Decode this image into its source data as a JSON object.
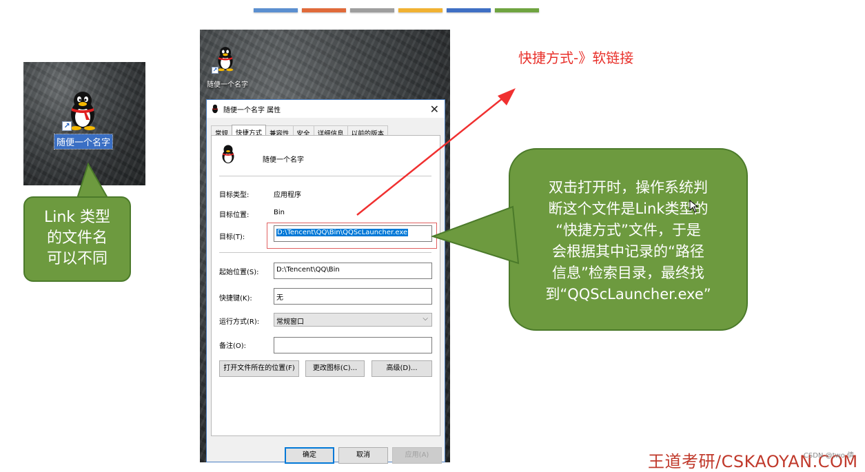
{
  "colors": {
    "bars": [
      "#5b8fd0",
      "#e06a3a",
      "#9e9e9e",
      "#f1b232",
      "#3f6fc4",
      "#6fa440"
    ],
    "callout_green": "#6d9a3f",
    "heading_red": "#e8302a",
    "selection_blue": "#0078d7"
  },
  "heading": "快捷方式-》软链接",
  "left_desktop": {
    "icon": "qq-penguin-icon",
    "label": "随便一个名字"
  },
  "left_callout": {
    "lines": [
      "Link 类型",
      "的文件名",
      "可以不同"
    ]
  },
  "dialog_desktop": {
    "icon": "qq-penguin-icon",
    "label": "随便一个名字"
  },
  "dialog": {
    "title": "随便一个名字 属性",
    "tabs": [
      "常规",
      "快捷方式",
      "兼容性",
      "安全",
      "详细信息",
      "以前的版本"
    ],
    "active_tab": "快捷方式",
    "name": "随便一个名字",
    "target_type_label": "目标类型:",
    "target_type_value": "应用程序",
    "target_location_label": "目标位置:",
    "target_location_value": "Bin",
    "target_label": "目标(T):",
    "target_value": "D:\\Tencent\\QQ\\Bin\\QQScLauncher.exe",
    "start_in_label": "起始位置(S):",
    "start_in_value": "D:\\Tencent\\QQ\\Bin",
    "shortcut_key_label": "快捷键(K):",
    "shortcut_key_value": "无",
    "run_label": "运行方式(R):",
    "run_value": "常规窗口",
    "comment_label": "备注(O):",
    "comment_value": "",
    "buttons": {
      "open_location": "打开文件所在的位置(F)",
      "change_icon": "更改图标(C)...",
      "advanced": "高级(D)..."
    },
    "footer": {
      "ok": "确定",
      "cancel": "取消",
      "apply": "应用(A)"
    }
  },
  "right_callout": {
    "lines": [
      "双击打开时，操作系统判",
      "断这个文件是Link类型的",
      "“快捷方式”文件，于是",
      "会根据其中记录的“路径",
      "信息”检索目录，最终找",
      "到“QQScLauncher.exe”"
    ]
  },
  "brand": "王道考研/CSKAOYAN.COM",
  "watermark": "CSDN @two 倩"
}
